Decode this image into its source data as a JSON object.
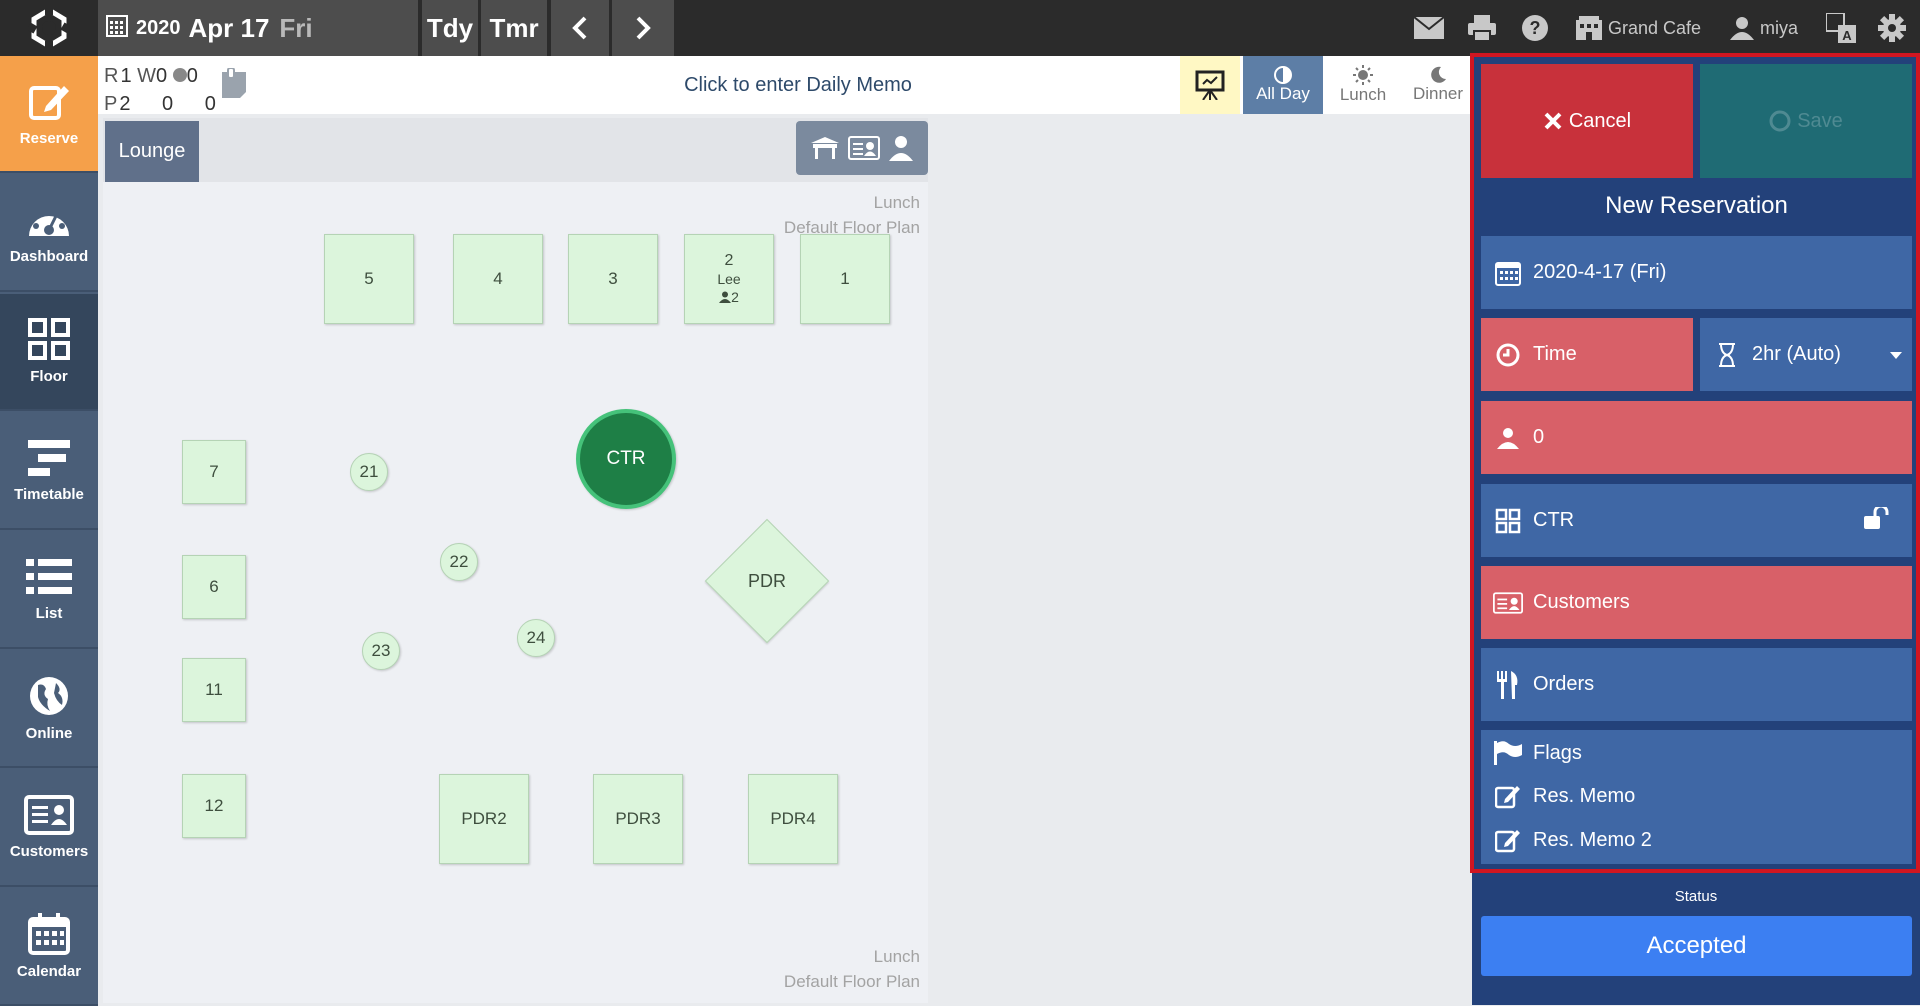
{
  "header": {
    "year": "2020",
    "month_day": "Apr 17",
    "weekday": "Fri",
    "today_label": "Tdy",
    "tomorrow_label": "Tmr",
    "store_name": "Grand Cafe",
    "user_name": "miya"
  },
  "sidebar": {
    "items": [
      {
        "label": "Reserve",
        "icon": "edit-icon"
      },
      {
        "label": "Dashboard",
        "icon": "gauge-icon"
      },
      {
        "label": "Floor",
        "icon": "grid-icon"
      },
      {
        "label": "Timetable",
        "icon": "timetable-icon"
      },
      {
        "label": "List",
        "icon": "list-icon"
      },
      {
        "label": "Online",
        "icon": "globe-icon"
      },
      {
        "label": "Customers",
        "icon": "id-card-icon"
      },
      {
        "label": "Calendar",
        "icon": "calendar-icon"
      }
    ]
  },
  "counts": {
    "r_label": "R",
    "r_val": "1",
    "w_label": "W",
    "w_val": "0",
    "o_val": "0",
    "p_label": "P",
    "p_val": "2",
    "p2": "0",
    "p3": "0"
  },
  "memo": {
    "placeholder": "Click to enter Daily Memo"
  },
  "shifts": {
    "all_day": "All Day",
    "lunch": "Lunch",
    "dinner": "Dinner"
  },
  "floor": {
    "tab": "Lounge",
    "plan_shift": "Lunch",
    "plan_name": "Default Floor Plan",
    "tables": [
      {
        "id": "t5",
        "label": "5"
      },
      {
        "id": "t4",
        "label": "4"
      },
      {
        "id": "t3",
        "label": "3"
      },
      {
        "id": "t2",
        "label": "2",
        "guest": "Lee",
        "party": "2"
      },
      {
        "id": "t1",
        "label": "1"
      },
      {
        "id": "t7",
        "label": "7"
      },
      {
        "id": "t21",
        "label": "21"
      },
      {
        "id": "tctr",
        "label": "CTR"
      },
      {
        "id": "t22",
        "label": "22"
      },
      {
        "id": "tpdr",
        "label": "PDR"
      },
      {
        "id": "t6",
        "label": "6"
      },
      {
        "id": "t23",
        "label": "23"
      },
      {
        "id": "t24",
        "label": "24"
      },
      {
        "id": "t11",
        "label": "11"
      },
      {
        "id": "t12",
        "label": "12"
      },
      {
        "id": "tpdr2",
        "label": "PDR2"
      },
      {
        "id": "tpdr3",
        "label": "PDR3"
      },
      {
        "id": "tpdr4",
        "label": "PDR4"
      }
    ]
  },
  "form": {
    "cancel": "Cancel",
    "save": "Save",
    "title": "New Reservation",
    "date": "2020-4-17 (Fri)",
    "time": "Time",
    "duration": "2hr (Auto)",
    "party": "0",
    "table": "CTR",
    "customers": "Customers",
    "orders": "Orders",
    "flags": "Flags",
    "memo1": "Res. Memo",
    "memo2": "Res. Memo 2",
    "status_label": "Status",
    "status": "Accepted"
  },
  "colors": {
    "accent_orange": "#f5a04a",
    "form_bg": "#23417a",
    "row_blue": "#3f67a5",
    "row_red": "#d86068",
    "cancel_red": "#c8313b",
    "accepted_blue": "#3c7ff2",
    "table_green": "#dcf5dc",
    "ctr_green": "#1e7f46"
  }
}
